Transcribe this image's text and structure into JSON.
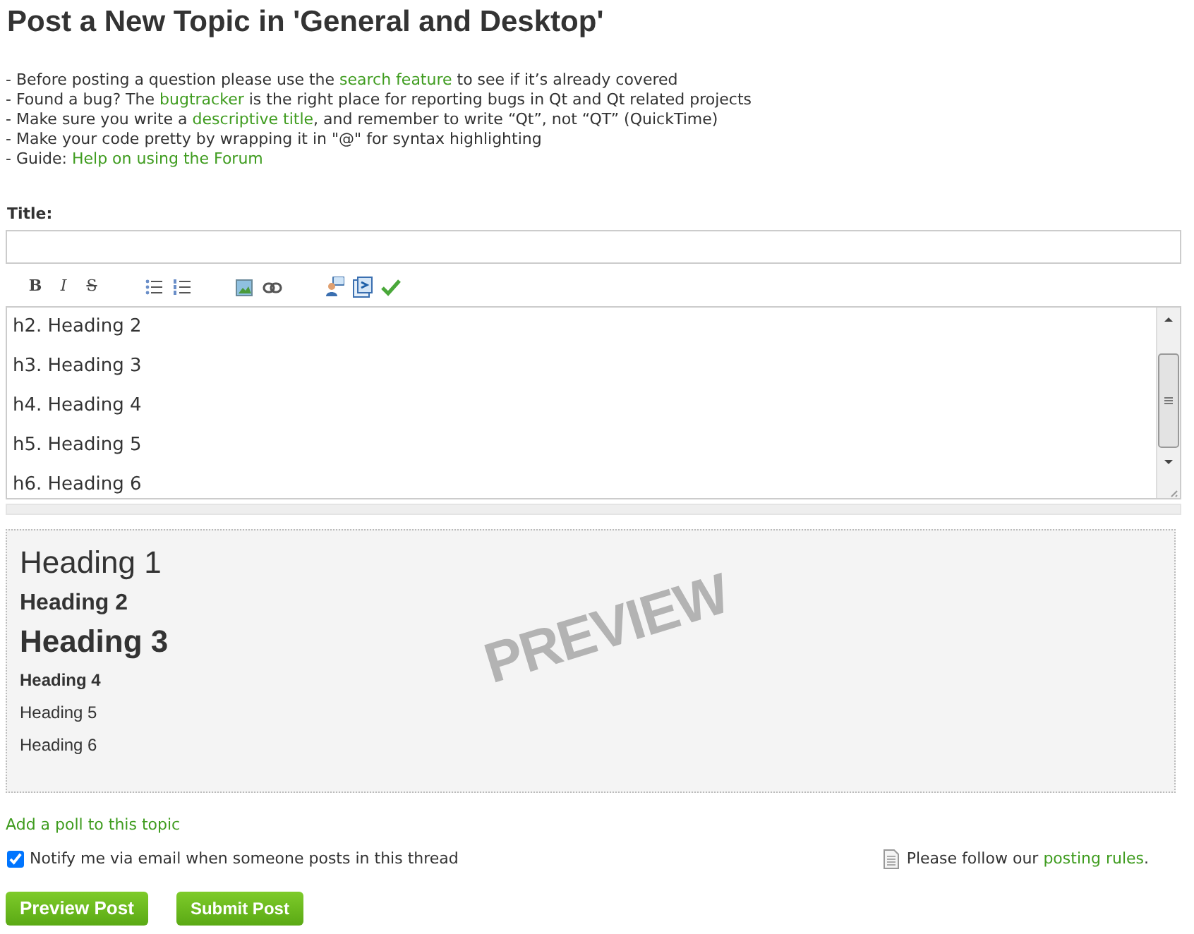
{
  "page_title": "Post a New Topic in 'General and Desktop'",
  "guidelines": [
    {
      "parts": [
        {
          "text": "- Before posting a question please use the "
        },
        {
          "link": "search feature"
        },
        {
          "text": " to see if it’s already covered"
        }
      ]
    },
    {
      "parts": [
        {
          "text": "- Found a bug? The "
        },
        {
          "link": "bugtracker"
        },
        {
          "text": " is the right place for reporting bugs in Qt and Qt related projects"
        }
      ]
    },
    {
      "parts": [
        {
          "text": "- Make sure you write a "
        },
        {
          "link": "descriptive title"
        },
        {
          "text": ", and remember to write “Qt”, not “QT” (QuickTime)"
        }
      ]
    },
    {
      "parts": [
        {
          "text": "- Make your code pretty by wrapping it in \"@\" for syntax highlighting"
        }
      ]
    },
    {
      "parts": [
        {
          "text": "- Guide: "
        },
        {
          "link": "Help on using the Forum"
        }
      ]
    }
  ],
  "title_label": "Title:",
  "toolbar": [
    {
      "kind": "bold",
      "text": "B"
    },
    {
      "kind": "italic",
      "text": "I"
    },
    {
      "kind": "strike",
      "text": "S"
    },
    {
      "kind": "bullets"
    },
    {
      "kind": "numbers"
    },
    {
      "kind": "image"
    },
    {
      "kind": "link"
    },
    {
      "kind": "user"
    },
    {
      "kind": "code"
    },
    {
      "kind": "check"
    }
  ],
  "editor_lines": [
    "h2. Heading 2",
    "h3. Heading 3",
    "h4. Heading 4",
    "h5. Heading 5",
    "h6. Heading 6"
  ],
  "preview": {
    "stamp": "PREVIEW",
    "items": [
      {
        "kind": "h1",
        "text": "Heading 1"
      },
      {
        "kind": "h2",
        "text": "Heading 2"
      },
      {
        "kind": "h3",
        "text": "Heading 3"
      },
      {
        "kind": "h4",
        "text": "Heading 4"
      },
      {
        "kind": "h5",
        "text": "Heading 5"
      },
      {
        "kind": "h6",
        "text": "Heading 6"
      }
    ]
  },
  "poll_link": "Add a poll to this topic",
  "notify": {
    "label": "Notify me via email when someone posts in this thread",
    "checked": true
  },
  "rules": {
    "text": "Please follow our ",
    "link": "posting rules",
    "after": "."
  },
  "buttons": [
    "Preview Post",
    "Submit Post"
  ]
}
